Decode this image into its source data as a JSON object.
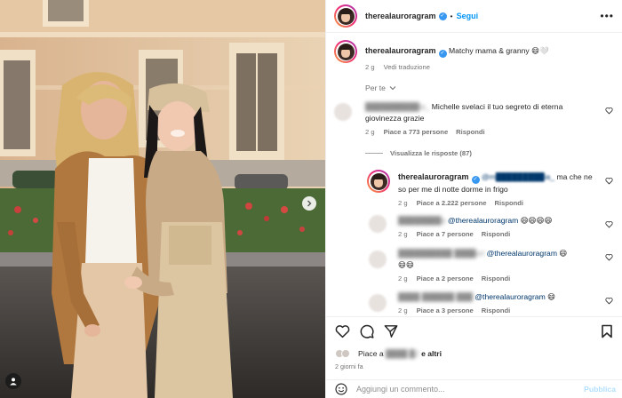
{
  "post": {
    "username": "therealauroragram",
    "follow_label": "Segui",
    "caption": "Matchy mama & granny 😄🤍",
    "caption_time": "2 g",
    "see_translation": "Vedi traduzione",
    "sort_label": "Per te"
  },
  "comments": [
    {
      "user": "██████████ia_",
      "text": "Michelle svelaci il tuo segreto di eterna giovinezza grazie",
      "time": "2 g",
      "likes": "Piace a 773 persone",
      "reply": "Rispondi",
      "view_replies": "Visualizza le risposte (87)"
    }
  ],
  "replies": [
    {
      "user": "therealauroragram",
      "mention": "@m█████████ia_",
      "text": "ma che ne so per me di notte dorme in frigo",
      "time": "2 g",
      "likes": "Piace a 2.222 persone",
      "reply": "Rispondi"
    },
    {
      "user": "████████a",
      "mention": "@therealauroragram",
      "text": "😄😄😄😄",
      "time": "2 g",
      "likes": "Piace a 7 persone",
      "reply": "Rispondi"
    },
    {
      "user": "██████████ ████ori",
      "mention": "@therealauroragram",
      "text": "😄",
      "text2": "😄😄",
      "time": "2 g",
      "likes": "Piace a 2 persone",
      "reply": "Rispondi"
    },
    {
      "user": "████ ██████ ███",
      "mention": "@therealauroragram",
      "text": "😄",
      "time": "2 g",
      "likes": "Piace a 3 persone",
      "reply": "Rispondi"
    }
  ],
  "footer": {
    "likes_prefix": "Piace a",
    "likes_hidden": "████ █2",
    "likes_suffix": "e altri",
    "date": "2 giorni fa",
    "comment_placeholder": "Aggiungi un commento...",
    "publish_label": "Pubblica"
  },
  "icons": {
    "like": "heart-icon",
    "comment": "comment-icon",
    "share": "send-icon",
    "save": "bookmark-icon",
    "emoji": "emoji-icon",
    "more": "more-icon",
    "carousel": "chevron-right-icon",
    "tags": "user-tag-icon"
  },
  "colors": {
    "accent": "#0095f6",
    "verified": "#3897f0",
    "muted": "#737373"
  }
}
